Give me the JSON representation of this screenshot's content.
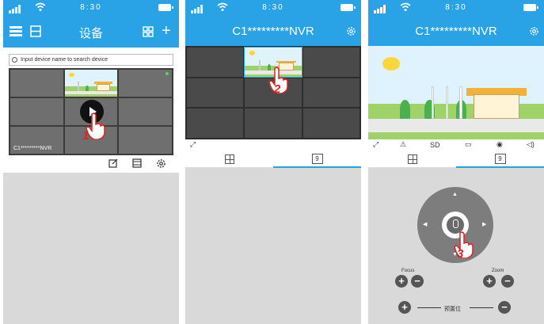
{
  "status": {
    "time": "8:30"
  },
  "screen1": {
    "title": "设备",
    "search_placeholder": "Input device name to search device",
    "device_label": "C1*********NVR",
    "step": "1"
  },
  "screen2": {
    "title": "C1*********NVR",
    "tab_grid_count": "9",
    "step": "2"
  },
  "screen3": {
    "title": "C1*********NVR",
    "toolbar": {
      "quality": "SD"
    },
    "tab_grid_count": "9",
    "focus_label": "Focus",
    "zoom_label": "Zoom",
    "preset_label": "预置位",
    "step": "3"
  },
  "icons": [
    "signal-icon",
    "wifi-icon",
    "battery-icon",
    "menu-icon",
    "scan-icon",
    "grid-icon",
    "add-icon",
    "search-icon",
    "edit-icon",
    "film-icon",
    "settings-icon",
    "fullscreen-icon",
    "alarm-icon",
    "record-icon",
    "snapshot-icon",
    "speaker-icon",
    "mic-icon",
    "hand-pointer-icon"
  ],
  "colors": {
    "accent": "#2aa3e6",
    "step_number": "#dd2222",
    "panel_bg": "#d9d9d9"
  }
}
